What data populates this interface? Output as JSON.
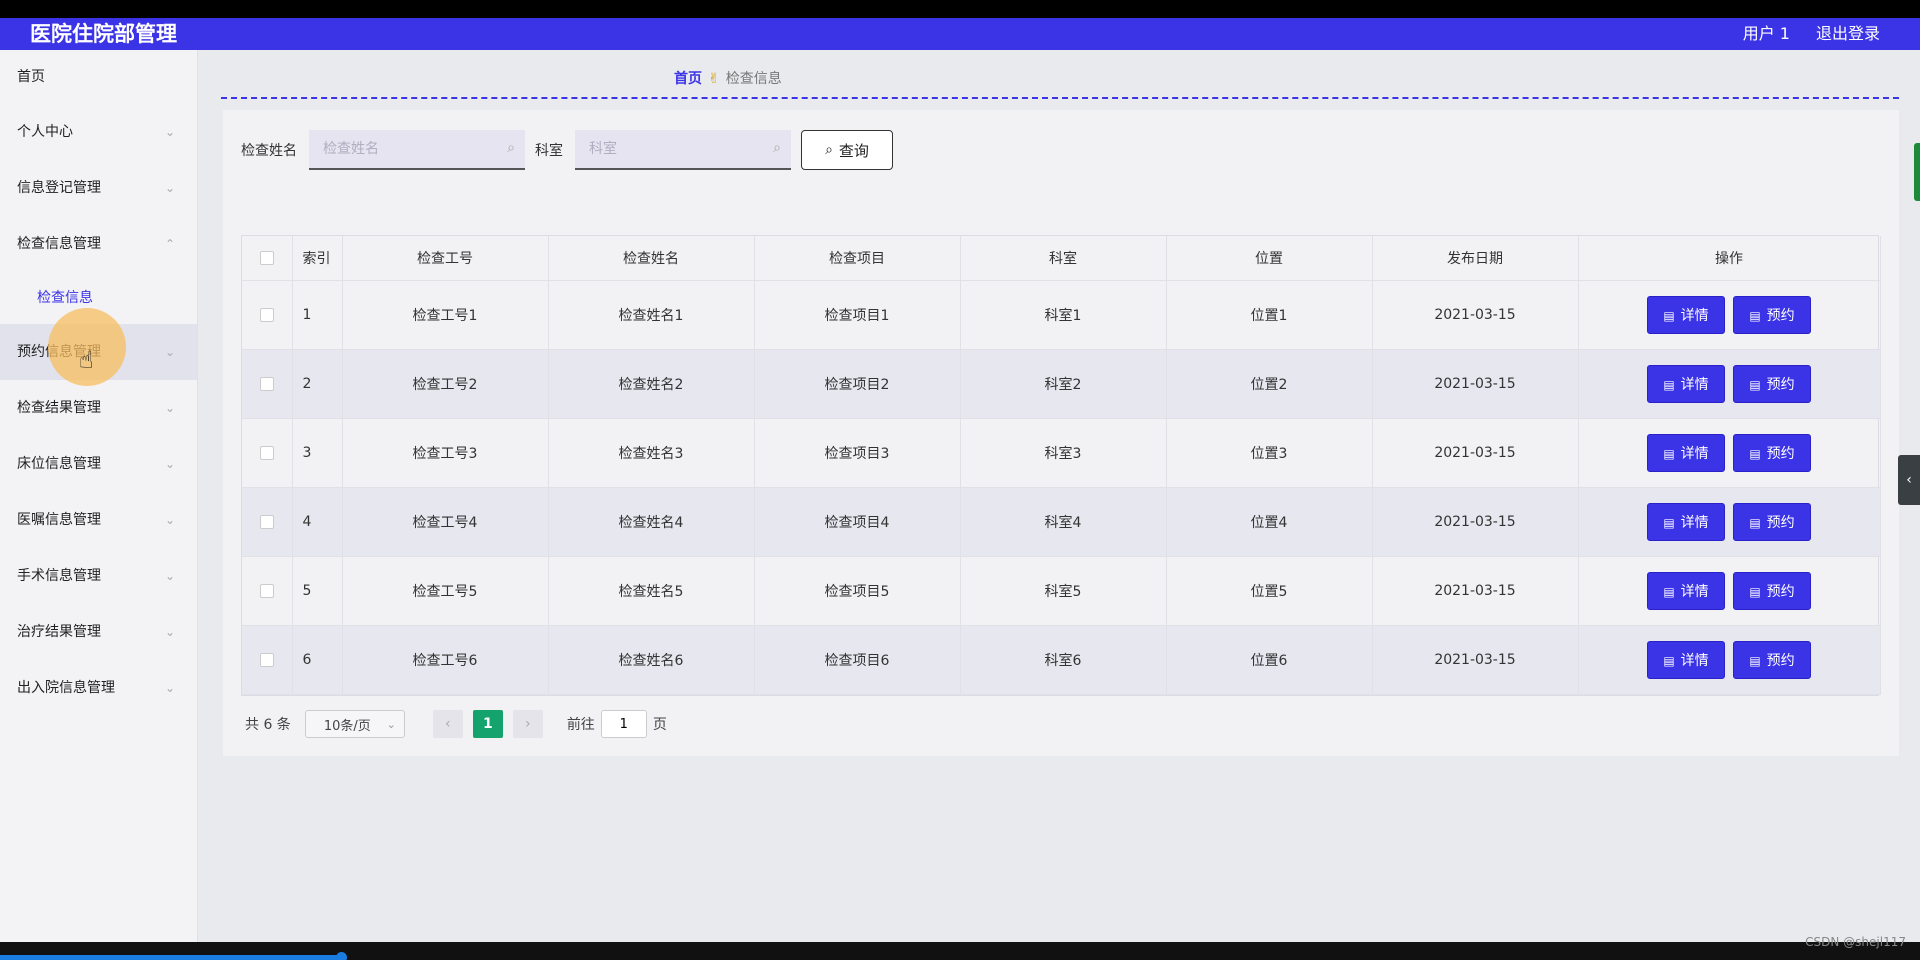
{
  "header": {
    "title": "医院住院部管理",
    "user": "用户 1",
    "logout": "退出登录",
    "accent_color": "#3b33e6"
  },
  "sidebar": {
    "items": [
      {
        "label": "首页",
        "chevron": ""
      },
      {
        "label": "个人中心",
        "chevron": "⌄"
      },
      {
        "label": "信息登记管理",
        "chevron": "⌄"
      },
      {
        "label": "检查信息管理",
        "chevron": "⌃"
      },
      {
        "label": "预约信息管理",
        "chevron": "⌄"
      },
      {
        "label": "检查结果管理",
        "chevron": "⌄"
      },
      {
        "label": "床位信息管理",
        "chevron": "⌄"
      },
      {
        "label": "医嘱信息管理",
        "chevron": "⌄"
      },
      {
        "label": "手术信息管理",
        "chevron": "⌄"
      },
      {
        "label": "治疗结果管理",
        "chevron": "⌄"
      },
      {
        "label": "出入院信息管理",
        "chevron": "⌄"
      }
    ],
    "submenu": {
      "label": "检查信息"
    }
  },
  "breadcrumb": {
    "home": "首页",
    "current": "检查信息"
  },
  "search": {
    "name_label": "检查姓名",
    "name_placeholder": "检查姓名",
    "dept_label": "科室",
    "dept_placeholder": "科室",
    "query_label": "查询"
  },
  "table": {
    "headers": [
      "索引",
      "检查工号",
      "检查姓名",
      "检查项目",
      "科室",
      "位置",
      "发布日期",
      "操作"
    ],
    "detail_label": "详情",
    "reserve_label": "预约",
    "rows": [
      [
        "1",
        "检查工号1",
        "检查姓名1",
        "检查项目1",
        "科室1",
        "位置1",
        "2021-03-15"
      ],
      [
        "2",
        "检查工号2",
        "检查姓名2",
        "检查项目2",
        "科室2",
        "位置2",
        "2021-03-15"
      ],
      [
        "3",
        "检查工号3",
        "检查姓名3",
        "检查项目3",
        "科室3",
        "位置3",
        "2021-03-15"
      ],
      [
        "4",
        "检查工号4",
        "检查姓名4",
        "检查项目4",
        "科室4",
        "位置4",
        "2021-03-15"
      ],
      [
        "5",
        "检查工号5",
        "检查姓名5",
        "检查项目5",
        "科室5",
        "位置5",
        "2021-03-15"
      ],
      [
        "6",
        "检查工号6",
        "检查姓名6",
        "检查项目6",
        "科室6",
        "位置6",
        "2021-03-15"
      ]
    ]
  },
  "pager": {
    "total": "共 6 条",
    "page_size": "10条/页",
    "current_page": "1",
    "goto_label": "前往",
    "goto_value": "1",
    "page_suffix": "页"
  },
  "watermark": "CSDN @shejl117"
}
